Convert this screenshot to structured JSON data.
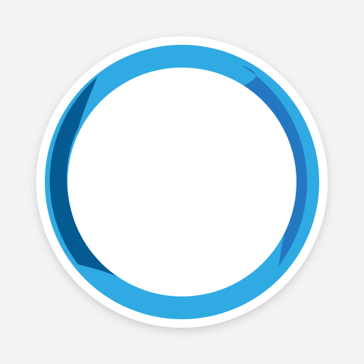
{
  "icon": {
    "name": "blue-ring-logo-icon",
    "colors": {
      "background": "#f3f3f3",
      "badge": "#ffffff",
      "ring_light": "#30aae2",
      "ring_mid": "#2478c2",
      "ring_dark": "#035b91",
      "center": "#ffffff"
    }
  }
}
